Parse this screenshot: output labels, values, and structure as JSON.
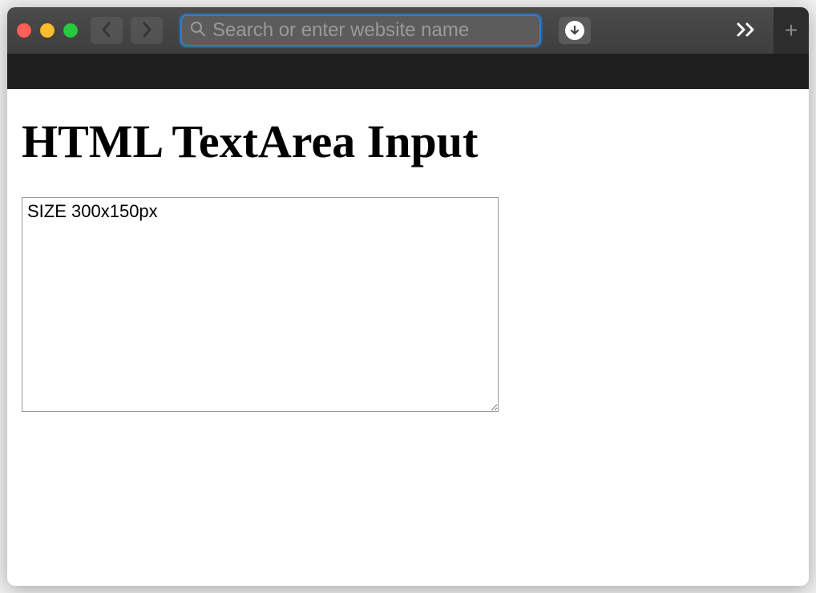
{
  "browser": {
    "search_placeholder": "Search or enter website name",
    "search_value": ""
  },
  "page": {
    "heading": "HTML TextArea Input",
    "textarea_value": "SIZE 300x150px"
  }
}
